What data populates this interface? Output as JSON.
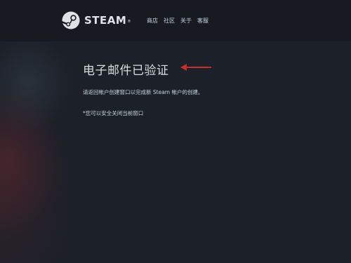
{
  "header": {
    "logo_text": "STEAM",
    "logo_tm": "®",
    "nav": [
      "商店",
      "社区",
      "关于",
      "客服"
    ]
  },
  "main": {
    "title": "电子邮件已验证",
    "description": "请返回帐户创建窗口以完成新 Steam 帐户的创建。",
    "note": "*您可以安全关闭当前窗口"
  },
  "colors": {
    "header_bg": "#171a21",
    "page_bg": "#1b2029",
    "annotation_arrow": "#c4302b"
  },
  "icons": {
    "logo": "steam-logo-icon",
    "annotation": "red-arrow-icon"
  }
}
